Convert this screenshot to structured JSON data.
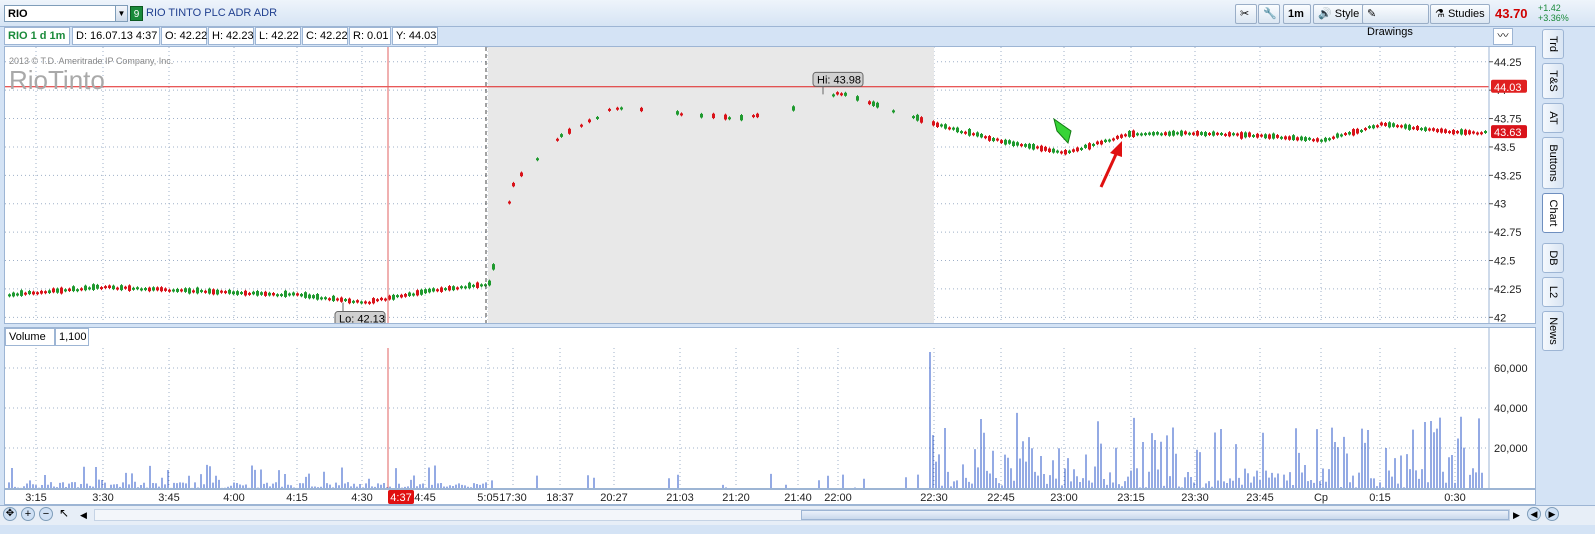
{
  "header": {
    "symbol": "RIO",
    "link_number": "9",
    "company_name": "RIO TINTO PLC ADR ADR",
    "buttons": [
      "1m",
      "Style",
      "Drawings",
      "Studies"
    ],
    "last_price": "43.70",
    "change": "+1.42",
    "change_pct": "+3.36%"
  },
  "info_bar": {
    "title": "RIO 1 d 1m",
    "date": "D: 16.07.13 4:37",
    "open": "O: 42.22",
    "high": "H: 42.23",
    "low": "L: 42.22",
    "close": "C: 42.22",
    "range": "R: 0.01",
    "y": "Y: 44.03"
  },
  "chart": {
    "copyright": "2013 © T.D. Ameritrade IP Company, Inc.",
    "logo": "RioTinto",
    "hi_label": "Hi: 43.98",
    "lo_label": "Lo: 42.13",
    "level_label": "44.03",
    "last_label": "43.63",
    "y_ticks": [
      "44.25",
      "44",
      "43.75",
      "43.5",
      "43.25",
      "43",
      "42.75",
      "42.5",
      "42.25",
      "42"
    ],
    "colors": {
      "up": "#1f9a2f",
      "down": "#d9131a",
      "level": "#e02020",
      "shade": "#e8e8e8"
    }
  },
  "volume": {
    "title": "Volume",
    "value": "1,100",
    "y_ticks": [
      "60,000",
      "40,000",
      "20,000"
    ]
  },
  "x_axis": {
    "labels": [
      "3:15",
      "3:30",
      "3:45",
      "4:00",
      "4:15",
      "4:30",
      "4:45",
      "5:05",
      "17:30",
      "18:37",
      "20:27",
      "21:03",
      "21:20",
      "21:40",
      "22:00",
      "22:30",
      "22:45",
      "23:00",
      "23:15",
      "23:30",
      "23:45",
      "Cp",
      "0:15",
      "0:30"
    ],
    "cursor_label": "4:37"
  },
  "sidebar": {
    "tabs": [
      "Trd",
      "T&S",
      "AT",
      "Buttons",
      "Chart",
      "DB",
      "L2",
      "News"
    ]
  },
  "chart_data": {
    "type": "candlestick",
    "ylim": [
      41.95,
      44.38
    ],
    "hi": 43.98,
    "lo": 42.13,
    "level_line": 44.03,
    "last": 43.63,
    "volume_ylim": [
      0,
      70000
    ],
    "price_path": [
      {
        "x": "3:10",
        "y": 42.2
      },
      {
        "x": "3:30",
        "y": 42.27
      },
      {
        "x": "3:45",
        "y": 42.24
      },
      {
        "x": "4:15",
        "y": 42.2
      },
      {
        "x": "4:30",
        "y": 42.13
      },
      {
        "x": "4:45",
        "y": 42.23
      },
      {
        "x": "5:05",
        "y": 42.3
      },
      {
        "x": "17:30",
        "y": 43.2
      },
      {
        "x": "18:37",
        "y": 43.6
      },
      {
        "x": "20:27",
        "y": 43.85
      },
      {
        "x": "21:20",
        "y": 43.75
      },
      {
        "x": "21:40",
        "y": 43.85
      },
      {
        "x": "22:00",
        "y": 43.98
      },
      {
        "x": "22:30",
        "y": 43.7
      },
      {
        "x": "22:45",
        "y": 43.55
      },
      {
        "x": "23:00",
        "y": 43.45
      },
      {
        "x": "23:15",
        "y": 43.62
      },
      {
        "x": "23:30",
        "y": 43.62
      },
      {
        "x": "23:45",
        "y": 43.6
      },
      {
        "x": "Cp",
        "y": 43.56
      },
      {
        "x": "0:15",
        "y": 43.7
      },
      {
        "x": "0:30",
        "y": 43.63
      }
    ]
  }
}
